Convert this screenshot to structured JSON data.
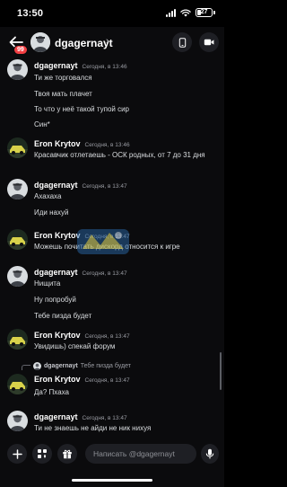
{
  "status_bar": {
    "time": "13:50",
    "battery": "27"
  },
  "header": {
    "badge_count": "99",
    "name": "dgagernayt",
    "chevron": "›"
  },
  "messages": [
    {
      "author": "dgagernayt",
      "time": "Сегодня, в 13:46",
      "lines": [
        "Ти же торговался",
        "Твоя мать плачет",
        "То что у неё такой тупой сир",
        "Син*"
      ]
    },
    {
      "author": "Eron Krytov",
      "time": "Сегодня, в 13:46",
      "lines": [
        "Красавчик отлетаешь - ОСК родных, от 7 до 31 дня"
      ]
    },
    {
      "author": "dgagernayt",
      "time": "Сегодня, в 13:47",
      "lines": [
        "Ахахаха",
        "Иди нахуй"
      ]
    },
    {
      "author": "Eron Krytov",
      "time": "Сегодня, в 13:47",
      "lines": [
        "Можешь почитать дискорд относится к игре"
      ]
    },
    {
      "author": "dgagernayt",
      "time": "Сегодня, в 13:47",
      "lines": [
        "Нищита",
        "Ну попробуй",
        "Тебе пизда будет"
      ]
    },
    {
      "author": "Eron Krytov",
      "time": "Сегодня, в 13:47",
      "lines": [
        "Увидишь) спекай форум"
      ]
    },
    {
      "author": "Eron Krytov",
      "time": "Сегодня, в 13:47",
      "reply": {
        "author": "dgagernayt",
        "text": "Тебе пизда будет"
      },
      "lines": [
        "Да? Пхаха"
      ]
    },
    {
      "author": "dgagernayt",
      "time": "Сегодня, в 13:47",
      "lines": [
        "Ти не знаешь не айди не ник нихуя"
      ]
    }
  ],
  "composer": {
    "placeholder": "Написать @dgagernayt"
  },
  "colors": {
    "background": "#0b0b0d",
    "text": "#dbdee1",
    "muted": "#9a9ca3",
    "badge": "#f23f43",
    "button_bg": "#1e1f24"
  }
}
